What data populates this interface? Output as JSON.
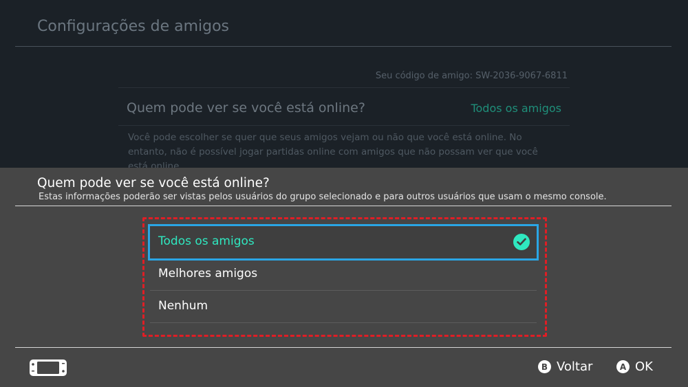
{
  "background": {
    "title": "Configurações de amigos",
    "friend_code": "Seu código de amigo: SW-2036-9067-6811",
    "question": "Quem pode ver se você está online?",
    "current_value": "Todos os amigos",
    "description": "Você pode escolher se quer que seus amigos vejam ou não que você está online. No entanto, não é possível jogar partidas online com amigos que não possam ver que você está online."
  },
  "sheet": {
    "title": "Quem pode ver se você está online?",
    "subtitle": "Estas informações poderão ser vistas pelos usuários do grupo selecionado e para outros usuários que usam o mesmo console.",
    "options": [
      {
        "label": "Todos os amigos",
        "selected": true
      },
      {
        "label": "Melhores amigos",
        "selected": false
      },
      {
        "label": "Nenhum",
        "selected": false
      }
    ]
  },
  "footer": {
    "back_button_glyph": "B",
    "back_label": "Voltar",
    "ok_button_glyph": "A",
    "ok_label": "OK"
  },
  "colors": {
    "accent": "#2fe8c0",
    "selection_border": "#2aa6e6",
    "annotation": "#e01e25"
  }
}
